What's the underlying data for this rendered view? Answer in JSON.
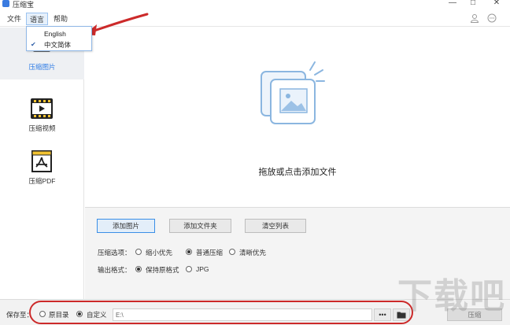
{
  "app": {
    "title": "压缩宝"
  },
  "window_controls": {
    "minimize": "—",
    "maximize": "□",
    "close": "✕"
  },
  "menu": {
    "items": [
      {
        "label": "文件"
      },
      {
        "label": "语言"
      },
      {
        "label": "帮助"
      }
    ]
  },
  "language_menu": {
    "items": [
      {
        "label": "English",
        "checked": false
      },
      {
        "label": "中文简体",
        "checked": true
      }
    ],
    "check_mark": "✔"
  },
  "sidebar": {
    "items": [
      {
        "label": "压缩图片",
        "icon": "image-icon",
        "active": true
      },
      {
        "label": "压缩视频",
        "icon": "video-icon",
        "active": false
      },
      {
        "label": "压缩PDF",
        "icon": "pdf-icon",
        "active": false
      }
    ]
  },
  "dropzone": {
    "label": "拖放或点击添加文件"
  },
  "toolbar": {
    "add_images": "添加图片",
    "add_folder": "添加文件夹",
    "clear_list": "清空列表"
  },
  "compress_options": {
    "label": "压缩选项：",
    "options": [
      "缩小优先",
      "普通压缩",
      "清晰优先"
    ],
    "selected": "普通压缩"
  },
  "output_format": {
    "label": "输出格式：",
    "options": [
      "保持原格式",
      "JPG"
    ],
    "selected": "保持原格式"
  },
  "save": {
    "label": "保存至：",
    "options": [
      "原目录",
      "自定义"
    ],
    "selected": "自定义",
    "path_value": "E:\\",
    "browse_label": "•••",
    "compress_label": "压缩"
  },
  "watermark": {
    "text": "下载吧"
  },
  "colors": {
    "accent": "#2d7be5",
    "annotation": "#cc2a2a"
  }
}
